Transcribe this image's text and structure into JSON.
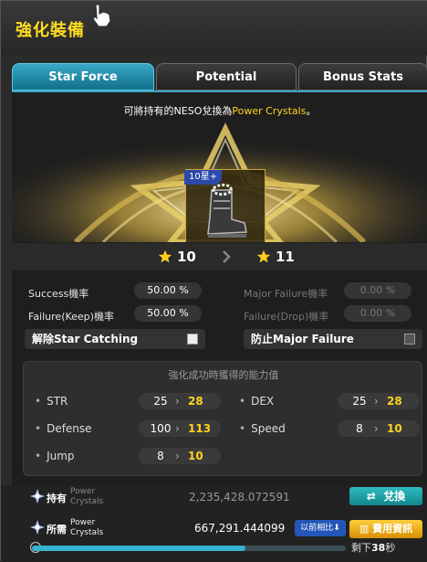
{
  "window": {
    "title": "強化裝備"
  },
  "tabs": [
    {
      "label": "Star Force",
      "active": true
    },
    {
      "label": "Potential",
      "active": false
    },
    {
      "label": "Bonus Stats",
      "active": false
    }
  ],
  "notice": {
    "prefix": "可將持有的NESO兌換為",
    "highlight": "Power Crystals",
    "suffix": "。"
  },
  "item": {
    "badge": "10星+",
    "icon": "boots-icon"
  },
  "stars": {
    "current": "10",
    "next": "11"
  },
  "rates": {
    "success_label": "Success機率",
    "success_value": "50.00 %",
    "failure_keep_label": "Failure(Keep)機率",
    "failure_keep_value": "50.00 %",
    "major_failure_label": "Major Failure機率",
    "major_failure_value": "0.00 %",
    "failure_drop_label": "Failure(Drop)機率",
    "failure_drop_value": "0.00 %"
  },
  "options": {
    "star_catch_label": "解除Star Catching",
    "star_catch_checked": false,
    "prevent_major_label": "防止Major Failure",
    "prevent_major_checked": false
  },
  "stat_panel": {
    "header": "強化成功時獲得的能力值",
    "stats": [
      {
        "name": "STR",
        "before": "25",
        "after": "28"
      },
      {
        "name": "DEX",
        "before": "25",
        "after": "28"
      },
      {
        "name": "Defense",
        "before": "100",
        "after": "113"
      },
      {
        "name": "Speed",
        "before": "8",
        "after": "10"
      },
      {
        "name": "Jump",
        "before": "8",
        "after": "10"
      }
    ]
  },
  "footer": {
    "owned_label": "持有",
    "owned_unit_1": "Power",
    "owned_unit_2": "Crystals",
    "owned_value": "2,235,428.072591",
    "exchange_button": "兌換",
    "required_label": "所需",
    "required_unit_1": "Power",
    "required_unit_2": "Crystals",
    "required_value": "667,291.444099",
    "compare_button": "以前相比",
    "fee_button": "費用資訊",
    "time_prefix": "剩下",
    "time_value": "38",
    "time_suffix": "秒",
    "progress": 0.68
  },
  "colors": {
    "accent_teal": "#39a9c6",
    "highlight_yellow": "#ffd21f",
    "fee_orange": "#f0a816"
  }
}
